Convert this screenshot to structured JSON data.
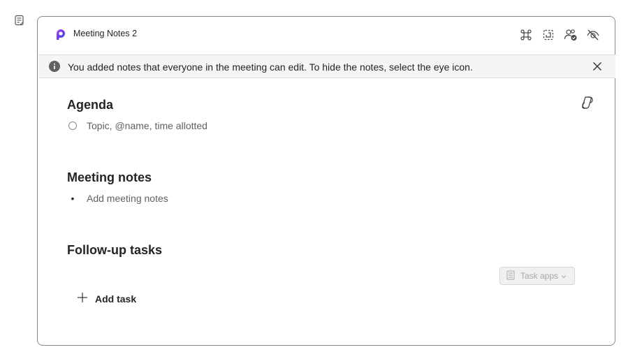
{
  "sidebar": {
    "icon": "notes-icon"
  },
  "header": {
    "title": "Meeting Notes 2",
    "logo_icon": "loop-logo-icon",
    "actions": [
      "loop-components-icon",
      "select-region-icon",
      "people-check-icon",
      "eye-off-icon"
    ]
  },
  "banner": {
    "text": "You added notes that everyone in the meeting can edit. To hide the notes, select the eye icon."
  },
  "agenda": {
    "title": "Agenda",
    "item_placeholder": "Topic, @name, time allotted"
  },
  "meeting_notes": {
    "title": "Meeting notes",
    "bullet": "•",
    "item_placeholder": "Add meeting notes"
  },
  "follow_up": {
    "title": "Follow-up tasks",
    "task_apps_label": "Task apps",
    "add_task_label": "Add task"
  },
  "colors": {
    "accent": "#7b3fe4",
    "border": "#8a8a8a",
    "banner_bg": "#f5f5f5",
    "text": "#242424"
  }
}
